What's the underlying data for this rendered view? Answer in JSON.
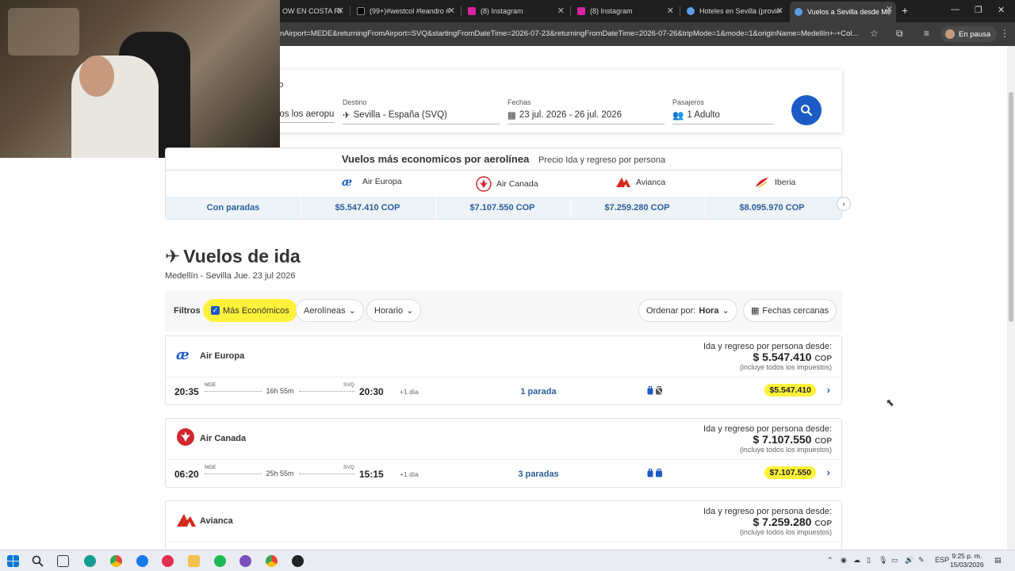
{
  "browser": {
    "tabs": [
      {
        "label": "OW EN COSTA RI",
        "color": "#ffffff"
      },
      {
        "label": "(99+)#westcol #leandro #",
        "color": "#000000"
      },
      {
        "label": "(8) Instagram",
        "color": "#d6249f"
      },
      {
        "label": "(8) Instagram",
        "color": "#d6249f"
      },
      {
        "label": "Hoteles en Sevilla (provin",
        "color": "#5c9ee8"
      },
      {
        "label": "Vuelos a Sevilla desde Me",
        "color": "#5c9ee8",
        "active": true
      }
    ],
    "url": "nAirport=MEDE&returningFromAirport=SVQ&startingFromDateTime=2026-07-23&returningFromDateTime=2026-07-26&tripMode=1&mode=1&originName=Medellín+-+Col...",
    "profile_label": "En pausa"
  },
  "search": {
    "origin_label": "so",
    "origin_value": "dos los aeropu",
    "dest_label": "Destino",
    "dest_value": "Sevilla - España (SVQ)",
    "dates_label": "Fechas",
    "dates_value": "23 jul. 2026 - 26 jul. 2026",
    "pax_label": "Pasajeros",
    "pax_value": "1 Adulto"
  },
  "airline_table": {
    "title": "Vuelos más economicos por aerolínea",
    "subtitle": "Precio Ida y regreso por persona",
    "row_label": "Con paradas",
    "airlines": [
      {
        "name": "Air Europa",
        "price": "$5.547.410 COP"
      },
      {
        "name": "Air Canada",
        "price": "$7.107.550 COP"
      },
      {
        "name": "Avianca",
        "price": "$7.259.280 COP"
      },
      {
        "name": "Iberia",
        "price": "$8.095.970 COP"
      }
    ]
  },
  "section": {
    "title": "Vuelos de ida",
    "subtitle": "Medellín - Sevilla Jue. 23 jul 2026"
  },
  "filters": {
    "label": "Filtros",
    "cheapest": "Más Económicos",
    "airlines": "Aerolíneas",
    "schedule": "Horario",
    "sort_prefix": "Ordenar por:",
    "sort_value": "Hora",
    "nearby_dates": "Fechas cercanas"
  },
  "flights": [
    {
      "airline": "Air Europa",
      "ida_label": "Ida y regreso por persona desde:",
      "price": "$ 5.547.410",
      "currency": "COP",
      "includes": "(incluye todos los impuestos)",
      "dep_time": "20:35",
      "dep_code": "MDE",
      "duration": "16h 55m",
      "arr_code": "SVQ",
      "arr_time": "20:30",
      "plus_day": "+1 día",
      "stops": "1 parada",
      "pill_price": "$5.547.410"
    },
    {
      "airline": "Air Canada",
      "ida_label": "Ida y regreso por persona desde:",
      "price": "$ 7.107.550",
      "currency": "COP",
      "includes": "(incluye todos los impuestos)",
      "dep_time": "06:20",
      "dep_code": "MDE",
      "duration": "25h 55m",
      "arr_code": "SVQ",
      "arr_time": "15:15",
      "plus_day": "+1 día",
      "stops": "3 paradas",
      "pill_price": "$7.107.550"
    },
    {
      "airline": "Avianca",
      "ida_label": "Ida y regreso por persona desde:",
      "price": "$ 7.259.280",
      "currency": "COP",
      "includes": "(incluye todos los impuestos)"
    }
  ],
  "taskbar": {
    "lang": "ESP",
    "time": "9:25 p. m.",
    "date": "15/03/2026"
  },
  "colors": {
    "accent_blue": "#1a5bc5",
    "highlight_yellow": "#fff23a",
    "link_blue": "#2a5f9e"
  }
}
